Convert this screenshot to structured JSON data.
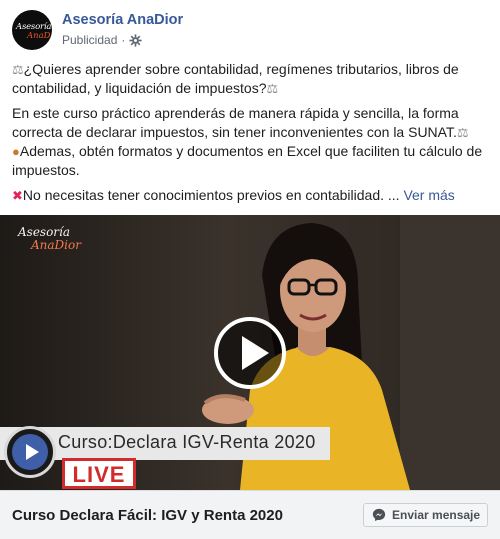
{
  "page": {
    "name": "Asesoría AnaDior",
    "meta": "Publicidad",
    "avatar_line1": "Asesoría",
    "avatar_line2": "AnaDior"
  },
  "post": {
    "p1_text": "¿Quieres aprender sobre contabilidad, regímenes tributarios, libros de contabilidad, y liquidación de impuestos?",
    "p2_text": "En este curso práctico aprenderás de manera rápida y sencilla, la forma correcta de declarar impuestos, sin tener inconvenientes con la SUNAT.",
    "p3_text": "Ademas, obtén formatos y documentos en Excel que faciliten tu cálculo de impuestos.",
    "p4_text": "No necesitas tener conocimientos previos en contabilidad. ...",
    "see_more": "Ver más",
    "icons": [
      "balance-scale-icon",
      "money-bag-icon",
      "cross-mark-icon"
    ]
  },
  "video": {
    "watermark_line1": "Asesoría",
    "watermark_line2": "AnaDior",
    "banner": "Curso:Declara IGV-Renta 2020",
    "live": "LIVE"
  },
  "footer": {
    "title": "Curso Declara Fácil: IGV y Renta 2020",
    "cta": "Enviar mensaje"
  },
  "colors": {
    "link": "#385898",
    "live_red": "#d22b2b",
    "shirt_yellow": "#e9b526"
  }
}
